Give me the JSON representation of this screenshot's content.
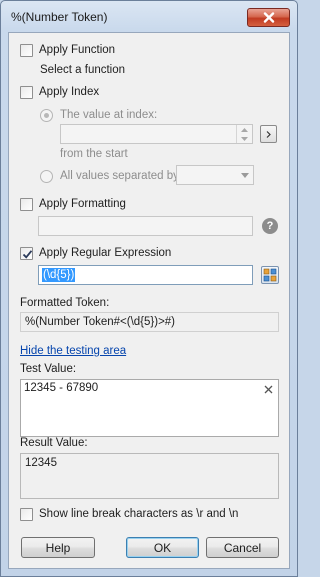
{
  "window": {
    "title": "%(Number Token)"
  },
  "apply_function": {
    "label": "Apply Function",
    "checked": false,
    "hint": "Select a function"
  },
  "apply_index": {
    "label": "Apply Index",
    "checked": false,
    "radio_value_at_index": "The value at index:",
    "index_value": "",
    "from_the_start": "from the  start",
    "radio_all_values": "All values separated by:",
    "separator_value": ""
  },
  "apply_formatting": {
    "label": "Apply Formatting",
    "checked": false,
    "value": ""
  },
  "apply_regex": {
    "label": "Apply Regular Expression",
    "checked": true,
    "value": "(\\d{5})"
  },
  "formatted_token": {
    "label": "Formatted Token:",
    "value": "%(Number Token#<(\\d{5})>#)"
  },
  "testing": {
    "hide_link": "Hide the testing area",
    "test_label": "Test Value:",
    "test_value": "12345 - 67890",
    "result_label": "Result Value:",
    "result_value": "12345"
  },
  "show_line_breaks": {
    "label": "Show line break characters as \\r and \\n",
    "checked": false
  },
  "buttons": {
    "help": "Help",
    "ok": "OK",
    "cancel": "Cancel"
  },
  "colors": {
    "selection": "#3399ff",
    "link": "#0645ad",
    "close": "#c13b22"
  },
  "icons": {
    "close": "close-icon",
    "next": "chevron-right-icon",
    "dropdown": "chevron-down-icon",
    "help": "question-mark-icon",
    "picker": "grid-picker-icon",
    "clear": "clear-icon"
  }
}
